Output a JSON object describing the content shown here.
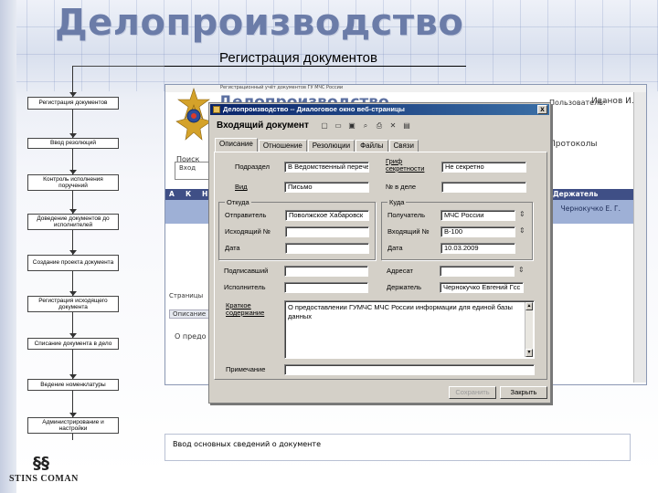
{
  "slide": {
    "title": "Делопроизводство",
    "subtitle": "Регистрация документов",
    "caption": "Ввод основных сведений о документе",
    "logo_text": "STINS COMAN"
  },
  "flowchart": {
    "steps": [
      "Регистрация документов",
      "Ввод резолюций",
      "Контроль исполнения поручений",
      "Доведение документов до исполнителей",
      "Создание проекта документа",
      "Регистрация исходящего документа",
      "Списание документа в дело",
      "Ведение номенклатуры",
      "Администрирование и настройки"
    ]
  },
  "webapp": {
    "topbar_text": "Регистрационный учёт документов ГУ МЧС России",
    "header_title": "Делопроизводство",
    "user_label": "Пользователь:",
    "user_name": "Иванов И. И.",
    "right_tabs": "Протоколы",
    "search_label": "Поиск",
    "search_value": "Вход",
    "table_headers": [
      "А",
      "К",
      "Н",
      "Держатель"
    ],
    "row_holder": "Чернокучко Е. Г.",
    "pages_label": "Страницы",
    "lower_tab": "Описание",
    "preview_text": "О предо"
  },
  "dialog": {
    "window_title": "Делопроизводство -- Диалоговое окно веб-страницы",
    "close_glyph": "x",
    "heading": "Входящий документ",
    "tabs": [
      "Описание",
      "Отношение",
      "Резолюции",
      "Файлы",
      "Связи"
    ],
    "active_tab": "Описание",
    "fields": {
      "podrazdel_label": "Подраздел",
      "podrazdel_value": "В Ведомственный перечень",
      "grif_label": "Гриф секретности",
      "grif_value": "Не секретно",
      "vid_label": "Вид",
      "vid_value": "Письмо",
      "nomer_dela_label": "№ в деле",
      "nomer_dela_value": ""
    },
    "otkuda": {
      "title": "Откуда",
      "otpravitel_label": "Отправитель",
      "otpravitel_value": "Поволжское Хабаровск",
      "ishodyaschiy_label": "Исходящий №",
      "ishodyaschiy_value": "",
      "data_label": "Дата",
      "data_value": ""
    },
    "kuda": {
      "title": "Куда",
      "poluchatel_label": "Получатель",
      "poluchatel_value": "МЧС России",
      "vhodyaschiy_label": "Входящий №",
      "vhodyaschiy_value": "В-100",
      "data_label": "Дата",
      "data_value": "10.03.2009"
    },
    "podpisant_label": "Подписавший",
    "podpisant_value": "",
    "adresat_label": "Адресат",
    "adresat_value": "",
    "ispolnitel_label": "Исполнитель",
    "ispolnitel_value": "",
    "derzhatel_label": "Держатель",
    "derzhatel_value": "Чернокучко Евгений Гсс",
    "summary_label": "Краткое содержание",
    "summary_value": "О предоставлении ГУМЧС МЧС России информации для единой базы данных",
    "notes_label": "Примечание",
    "notes_value": "",
    "btn_save": "Сохранить",
    "btn_close": "Закрыть"
  }
}
